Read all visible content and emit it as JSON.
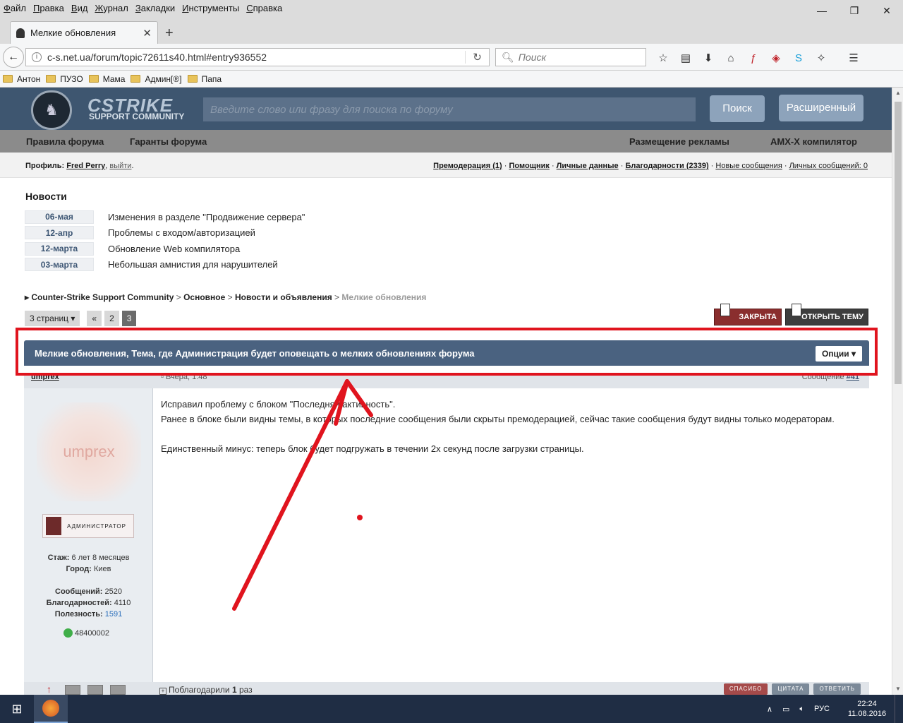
{
  "menubar": {
    "items": [
      "Файл",
      "Правка",
      "Вид",
      "Журнал",
      "Закладки",
      "Инструменты",
      "Справка"
    ],
    "accel": [
      "Ф",
      "П",
      "В",
      "Ж",
      "З",
      "И",
      "С"
    ],
    "rest": [
      "айл",
      "равка",
      "ид",
      "урнал",
      "акладки",
      "нструменты",
      "правка"
    ]
  },
  "window": {
    "minimize": "—",
    "restore": "❐",
    "close": "✕"
  },
  "tab": {
    "title": "Мелкие обновления",
    "close": "✕",
    "new": "+"
  },
  "nav": {
    "back": "←",
    "url": "c-s.net.ua/forum/topic72611s40.html#entry936552",
    "reload": "↻",
    "search_placeholder": "Поиск"
  },
  "bookmarks": [
    "Антон",
    "ПУЗО",
    "Мама",
    "Админ[®]",
    "Папа"
  ],
  "header": {
    "logo_line1": "CSTRIKE",
    "logo_line2": "SUPPORT COMMUNITY",
    "search_placeholder": "Введите слово или фразу для поиска по форуму",
    "search_button": "Поиск",
    "advanced_button": "Расширенный"
  },
  "navstrip": {
    "rules": "Правила форума",
    "guarantors": "Гаранты форума",
    "ads": "Размещение рекламы",
    "compiler": "AMX-X компилятор"
  },
  "profile": {
    "label": "Профиль:",
    "user": "Fred Perry",
    "logout": "выйти",
    "links": {
      "premod": "Премодерация (1)",
      "helper": "Помощник",
      "personal": "Личные данные",
      "thanks": "Благодарности (2339)",
      "new_msgs": "Новые сообщения",
      "pm": "Личных сообщений: 0"
    }
  },
  "news": {
    "heading": "Новости",
    "items": [
      {
        "date": "06-мая",
        "title": "Изменения в разделе \"Продвижение сервера\""
      },
      {
        "date": "12-апр",
        "title": "Проблемы с входом/авторизацией"
      },
      {
        "date": "12-марта",
        "title": "Обновление Web компилятора"
      },
      {
        "date": "03-марта",
        "title": "Небольшая амнистия для нарушителей"
      }
    ]
  },
  "breadcrumb": {
    "c1": "Counter-Strike Support Community",
    "c2": "Основное",
    "c3": "Новости и объявления",
    "current": "Мелкие обновления"
  },
  "pager": {
    "pages_label": "3 страниц",
    "prev": "«",
    "p2": "2",
    "p3": "3"
  },
  "topic_buttons": {
    "closed": "ЗАКРЫТА",
    "open_topic": "ОТКРЫТЬ ТЕМУ"
  },
  "topic": {
    "title": "Мелкие обновления, Тема, где Администрация будет оповещать о мелких обновлениях форума",
    "options": "Опции"
  },
  "post": {
    "author": "umprex",
    "time": "Вчера, 1:48",
    "num_label": "Сообщение",
    "num": "#41",
    "avatar_text": "umprex",
    "rank": "АДМИНИСТРАТОР",
    "stats": {
      "exp_label": "Стаж:",
      "exp": "6 лет 8 месяцев",
      "city_label": "Город:",
      "city": "Киев",
      "msgs_label": "Сообщений:",
      "msgs": "2520",
      "thanks_label": "Благодарностей:",
      "thanks": "4110",
      "useful_label": "Полезность:",
      "useful": "1591"
    },
    "reputation": "48400002",
    "p1": "Исправил проблему с блоком \"Последняя активность\".",
    "p2": "Ранее в блоке были видны темы, в которых последние сообщения были скрыты премодерацией, сейчас такие сообщения будут видны только модераторам.",
    "p3": "Единственный минус: теперь блок будет подгружать в течении 2х секунд после загрузки страницы.",
    "thanked_label": "Поблагодарили",
    "thanked_count": "1",
    "thanked_suffix": "раз",
    "btn_thanks": "СПАСИБО",
    "btn_quote": "ЦИТАТА",
    "btn_reply": "ОТВЕТИТЬ"
  },
  "taskbar": {
    "lang": "РУС",
    "time": "22:24",
    "date": "11.08.2016"
  },
  "annotation_color": "#e0141e"
}
